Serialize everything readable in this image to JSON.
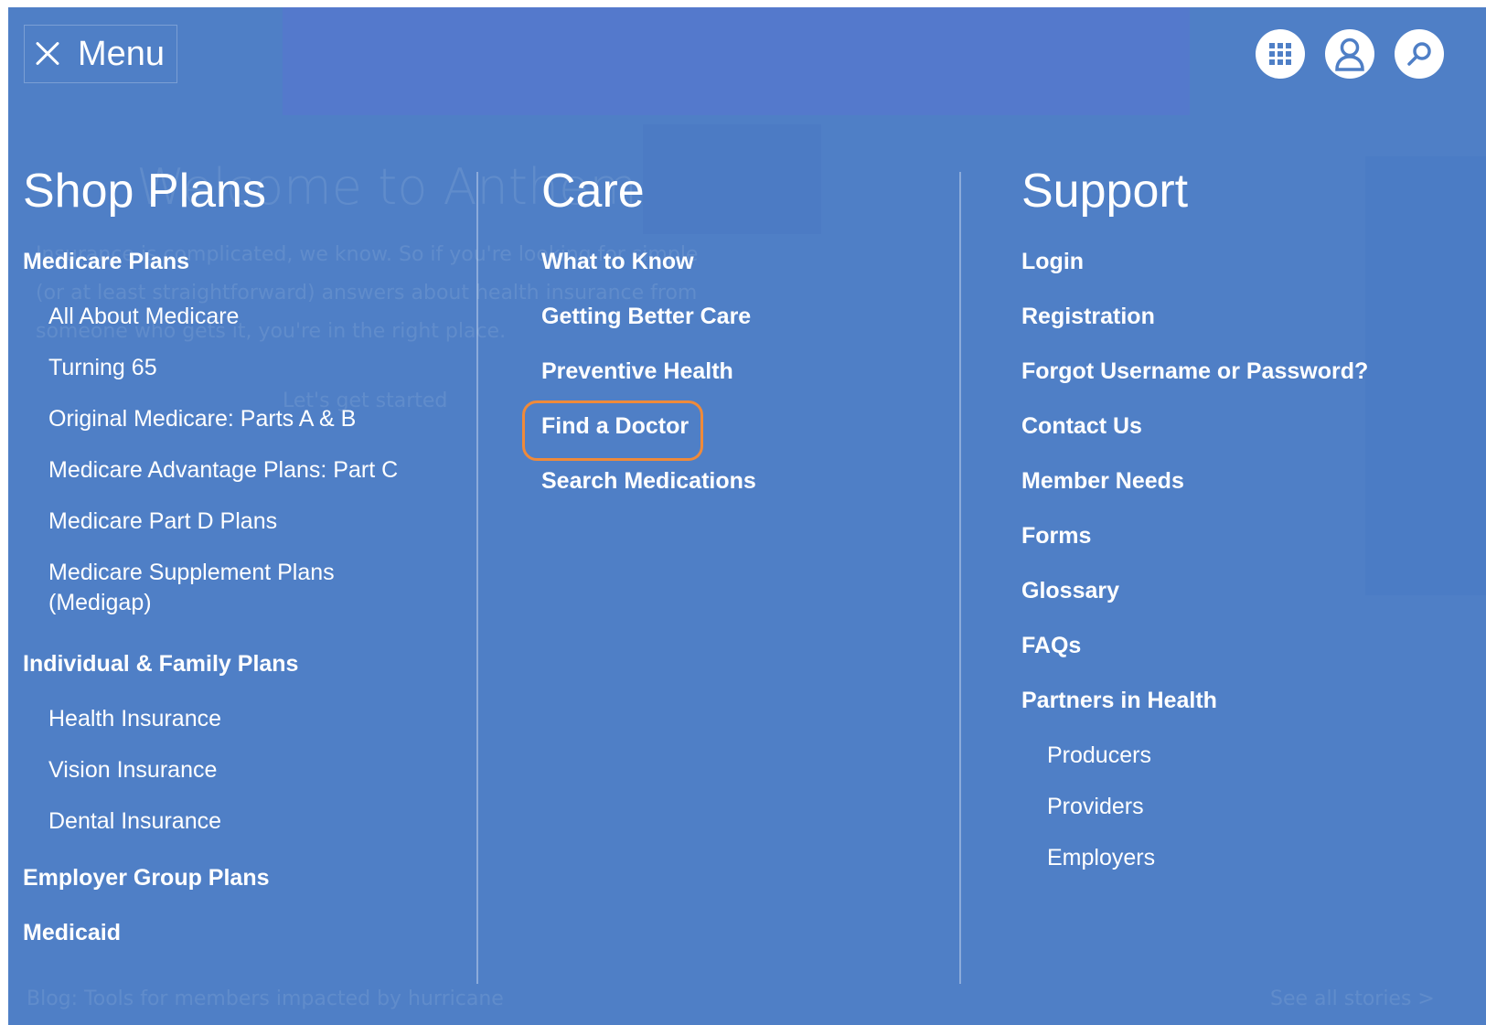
{
  "topbar": {
    "menu_label": "Menu",
    "icons": [
      "grid-icon",
      "user-icon",
      "search-icon"
    ]
  },
  "shop": {
    "title": "Shop Plans",
    "medicare_plans": "Medicare Plans",
    "medicare_items": [
      "All About Medicare",
      "Turning 65",
      "Original Medicare: Parts A & B",
      "Medicare Advantage Plans: Part C",
      "Medicare Part D Plans",
      "Medicare Supplement Plans (Medigap)"
    ],
    "individual_family": "Individual & Family Plans",
    "individual_items": [
      "Health Insurance",
      "Vision Insurance",
      "Dental Insurance"
    ],
    "employer_group": "Employer Group Plans",
    "medicaid": "Medicaid"
  },
  "care": {
    "title": "Care",
    "items": [
      "What to Know",
      "Getting Better Care",
      "Preventive Health",
      "Find a Doctor",
      "Search Medications"
    ]
  },
  "support": {
    "title": "Support",
    "items": [
      "Login",
      "Registration",
      "Forgot Username or Password?",
      "Contact Us",
      "Member Needs",
      "Forms",
      "Glossary",
      "FAQs",
      "Partners in Health"
    ],
    "partner_items": [
      "Producers",
      "Providers",
      "Employers"
    ]
  },
  "background_text": {
    "heading": "Welcome to Anthem",
    "line1": "Insurance is complicated, we know. So if you're looking for simple",
    "line2": "(or at least straightforward) answers about health insurance from",
    "line3": "someone who gets it, you're in the right place.",
    "cta": "Let's get started",
    "footer_left": "Blog: Tools for members impacted by hurricane",
    "footer_right": "See all stories >"
  },
  "colors": {
    "panel": "#4f7fc6",
    "highlight": "#ef8a3a"
  }
}
